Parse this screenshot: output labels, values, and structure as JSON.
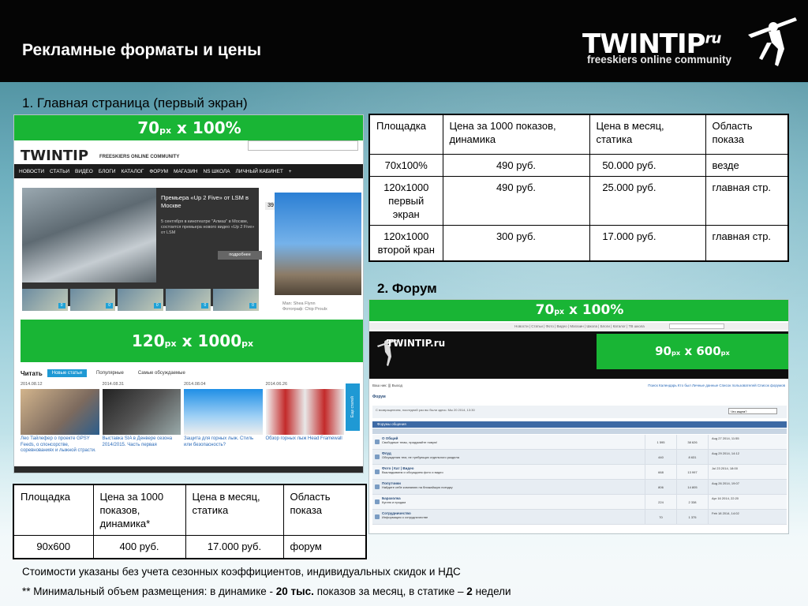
{
  "header": {
    "title": "Рекламные форматы и цены",
    "logo": {
      "main": "TWINTIP",
      "ru": "ru",
      "tagline": "freeskiers online community"
    }
  },
  "section1": {
    "title": "1. Главная страница (первый экран)",
    "mockup": {
      "top_banner": {
        "size": "70",
        "unit": "px",
        "rest": " x 100%"
      },
      "logo": "TWINTIP",
      "logo_tagline": "FREESKIERS ONLINE COMMUNITY",
      "nav": [
        "НОВОСТИ",
        "СТАТЬИ",
        "ВИДЕО",
        "БЛОГИ",
        "КАТАЛОГ",
        "ФОРУМ",
        "МАГАЗИН",
        "NS ШКОЛА",
        "ЛИЧНЫЙ КАБИНЕТ",
        "+"
      ],
      "feature": {
        "title": "Премьера «Up 2 Five» от LSM в Москве",
        "desc": "5 сентября в кинотеатре \"Алмаз\" в Москве, состоится премьера нового видео «Up 2 Five» от LSM",
        "more": "подробнее"
      },
      "thumb_badge": "0",
      "photo_badge": "39",
      "caption": [
        "Man: Shea Flynn",
        "Фотограф: Chip Proulx"
      ],
      "mid_banner": {
        "size1": "120",
        "unit1": "px",
        "mid": " x 1000",
        "unit2": "px"
      },
      "tabs": {
        "read": "Читать",
        "new": "Новые статьи",
        "popular": "Популярные",
        "discussed": "Самые обсуждаемые"
      },
      "articles": [
        {
          "date": "2014.08.12",
          "title": "Лео Тайлефер о проекте GPSY Feeds, о спонсорстве, соревнованиях и лыжной страсти."
        },
        {
          "date": "2014.08.31",
          "title": "Выставка SIA в Денвере сезона 2014/2015. Часть первая"
        },
        {
          "date": "2014.08.04",
          "title": "Защита для горных лыж. Стиль или безопасность?"
        },
        {
          "date": "2014.06.26",
          "title": "Обзор горных лыж Head Framewall"
        }
      ],
      "side_strip": "Еще статей"
    },
    "table": {
      "headers": [
        "Площадка",
        "Цена за 1000 показов, динамика",
        "Цена в месяц, статика",
        "Область показа"
      ],
      "rows": [
        [
          "70x100%",
          "490 руб.",
          "50.000 руб.",
          "везде"
        ],
        [
          "120x1000 первый экран",
          "490 руб.",
          "25.000 руб.",
          "главная стр."
        ],
        [
          "120x1000 второй кран",
          "300 руб.",
          "17.000 руб.",
          "главная стр."
        ]
      ]
    }
  },
  "section2": {
    "title": "2. Форум",
    "mockup": {
      "top_banner": {
        "size": "70",
        "unit": "px",
        "rest": " x 100%"
      },
      "topnav": "Новости | Статьи | Фото | Видео | Магазин | Школа | Блоги | Каталог | ТВ школа",
      "banner_logo": "TWINTIP.ru",
      "side_banner": {
        "size": "90",
        "unit1": "px",
        "mid": " x 600",
        "unit2": "px"
      },
      "crumb": "Ваш ник: ||| Выход",
      "toplinks": "Поиск  Календарь  Кто был  Личные данные  Список пользователей  Список форумов",
      "forum_label": "Форум",
      "welcome": "С возвращением, последний раз вы были здесь: Мы 20 2014, 13:30",
      "welcome_input": "Что ищем?",
      "table_head": "Форумы общения",
      "rows": [
        {
          "name": "О Общий",
          "desc": "Свободные темы, придумайте новую!",
          "n1": "1 595",
          "n2": "38 626",
          "last": "Aug 27 2014, 11:55"
        },
        {
          "name": "Флуд",
          "desc": "Обсуждения тем, не требующих отдельного раздела",
          "n1": "440",
          "n2": "8 631",
          "last": "Aug 29 2014, 14:12"
        },
        {
          "name": "Фото | Кат | Видео",
          "desc": "Выкладываем и обсуждаем фото и видео",
          "n1": "668",
          "n2": "13 997",
          "last": "Jul 23 2014, 18:00"
        },
        {
          "name": "Попутчики",
          "desc": "Найдите себе компанию на ближайшую поездку",
          "n1": "806",
          "n2": "14 805",
          "last": "Aug 26 2014, 19:07"
        },
        {
          "name": "Барахолка",
          "desc": "Куплю и продам",
          "n1": "224",
          "n2": "2 338",
          "last": "Apr 16 2014, 22:20"
        },
        {
          "name": "Сотрудничество",
          "desc": "Информация о сотрудничестве",
          "n1": "70",
          "n2": "1 375",
          "last": "Feb 18 2014, 14:02"
        }
      ]
    },
    "table": {
      "headers": [
        "Площадка",
        "Цена за 1000 показов, динамика*",
        "Цена в месяц, статика",
        "Область показа"
      ],
      "rows": [
        [
          "90x600",
          "400 руб.",
          "17.000 руб.",
          "форум"
        ]
      ]
    }
  },
  "notes": {
    "note1": "Стоимости указаны без учета сезонных коэффициентов, индивидуальных скидок и НДС",
    "note2_pre": "** Минимальный объем размещения: в динамике - ",
    "note2_b1": "20 тыс.",
    "note2_mid": " показов за месяц, в статике – ",
    "note2_b2": "2",
    "note2_post": " недели"
  }
}
